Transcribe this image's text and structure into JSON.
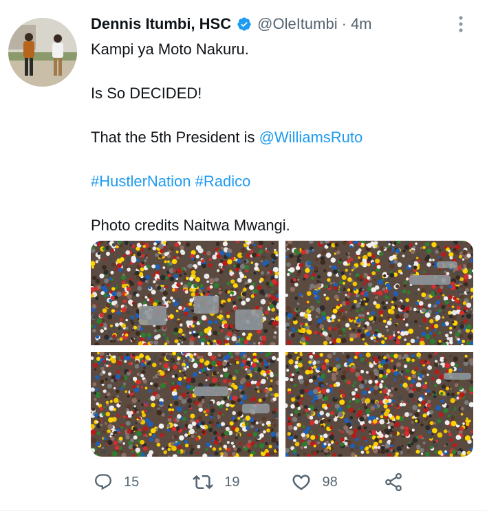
{
  "tweet": {
    "author": {
      "display_name": "Dennis Itumbi, HSC",
      "handle": "@OleItumbi",
      "time": "4m",
      "verified": true
    },
    "text": {
      "line1": "Kampi ya Moto Nakuru.",
      "line2": "Is So DECIDED!",
      "line3_prefix": "That the 5th President is ",
      "line3_mention": "@WilliamsRuto",
      "hashtag1": "#HustlerNation",
      "hashtag2": "#Radico",
      "line5": "Photo credits Naitwa Mwangi."
    },
    "actions": {
      "replies": "15",
      "retweets": "19",
      "likes": "98"
    },
    "colors": {
      "link": "#1d9bf0",
      "secondary_text": "#536471",
      "verified_badge": "#1d9bf0"
    }
  }
}
